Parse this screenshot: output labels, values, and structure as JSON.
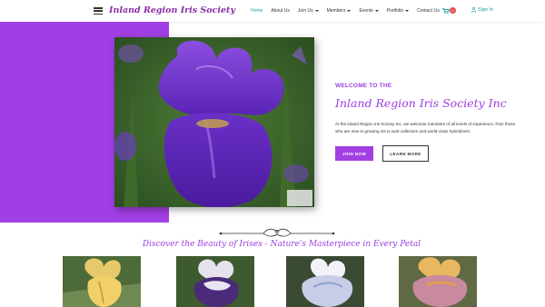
{
  "header": {
    "site_title": "Inland Region Iris Society",
    "nav": [
      {
        "label": "Home",
        "active": true,
        "dropdown": false
      },
      {
        "label": "About Us",
        "active": false,
        "dropdown": false
      },
      {
        "label": "Join Us",
        "active": false,
        "dropdown": true
      },
      {
        "label": "Members",
        "active": false,
        "dropdown": true
      },
      {
        "label": "Events",
        "active": false,
        "dropdown": true
      },
      {
        "label": "Portfolio",
        "active": false,
        "dropdown": true
      },
      {
        "label": "Contact Us",
        "active": false,
        "dropdown": false
      }
    ],
    "cart_count": "0",
    "signin_label": "Sign In"
  },
  "hero": {
    "kicker": "WELCOME TO THE",
    "title": "Inland Region Iris Society Inc",
    "text": "At the Inland Region Iris Society Inc, we welcome members of all levels of experience, from those who are new to growing iris to avid collectors and world-class hybridizers.",
    "join_label": "JOIN NOW",
    "learn_label": "LEARN MORE"
  },
  "discover": {
    "heading": "Discover the Beauty of Irises - Nature's Masterpiece in Every Petal"
  },
  "colors": {
    "accent_purple": "#a13fe4",
    "teal": "#1aa3a3",
    "badge_red": "#e84b4b"
  },
  "icons": [
    "hamburger-icon",
    "cart-icon",
    "user-icon",
    "ornament-divider"
  ]
}
